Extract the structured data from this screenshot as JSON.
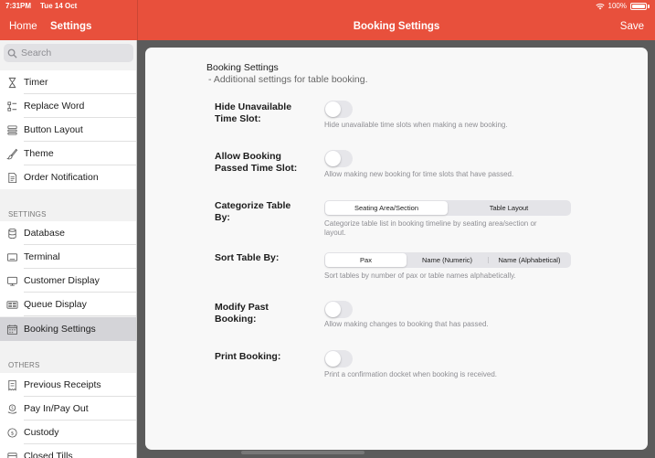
{
  "status_bar": {
    "time": "7:31PM",
    "date": "Tue 14 Oct",
    "battery": "100%"
  },
  "nav": {
    "home": "Home",
    "settings": "Settings",
    "title": "Booking Settings",
    "save": "Save"
  },
  "sidebar": {
    "search_placeholder": "Search",
    "items_top": [
      {
        "label": "Timer",
        "icon": "hourglass-icon"
      },
      {
        "label": "Replace Word",
        "icon": "replace-word-icon"
      },
      {
        "label": "Button Layout",
        "icon": "button-layout-icon"
      },
      {
        "label": "Theme",
        "icon": "paint-brush-icon"
      },
      {
        "label": "Order Notification",
        "icon": "notification-doc-icon"
      }
    ],
    "section_settings": "SETTINGS",
    "items_settings": [
      {
        "label": "Database",
        "icon": "database-icon"
      },
      {
        "label": "Terminal",
        "icon": "terminal-icon"
      },
      {
        "label": "Customer Display",
        "icon": "customer-display-icon"
      },
      {
        "label": "Queue Display",
        "icon": "queue-display-icon"
      },
      {
        "label": "Booking Settings",
        "icon": "calendar-icon"
      }
    ],
    "section_others": "OTHERS",
    "items_others": [
      {
        "label": "Previous Receipts",
        "icon": "receipt-icon"
      },
      {
        "label": "Pay In/Pay Out",
        "icon": "pay-in-out-icon"
      },
      {
        "label": "Custody",
        "icon": "custody-icon"
      },
      {
        "label": "Closed Tills",
        "icon": "closed-tills-icon"
      }
    ]
  },
  "content": {
    "title": "Booking Settings",
    "subtitle": "- Additional settings for table booking.",
    "hide_unavailable": {
      "label": "Hide Unavailable Time Slot:",
      "desc": "Hide unavailable time slots when making a new booking.",
      "on": false
    },
    "allow_passed": {
      "label": "Allow Booking Passed Time Slot:",
      "desc": "Allow making new booking for time slots that have passed.",
      "on": false
    },
    "categorize": {
      "label": "Categorize Table By:",
      "options": [
        "Seating Area/Section",
        "Table Layout"
      ],
      "selected": "Seating Area/Section",
      "desc": "Categorize table list in booking timeline by seating area/section or layout."
    },
    "sort": {
      "label": "Sort Table By:",
      "options": [
        "Pax",
        "Name (Numeric)",
        "Name (Alphabetical)"
      ],
      "selected": "Pax",
      "desc": "Sort tables by number of pax or table names alphabetically."
    },
    "modify_past": {
      "label": "Modify Past Booking:",
      "desc": "Allow making changes to booking that has passed.",
      "on": false
    },
    "print_booking": {
      "label": "Print Booking:",
      "desc": "Print a confirmation docket when booking is received.",
      "on": false
    }
  },
  "colors": {
    "header": "#e8503c",
    "selected_row": "#d4d4d8",
    "card": "#f8f8f8"
  }
}
